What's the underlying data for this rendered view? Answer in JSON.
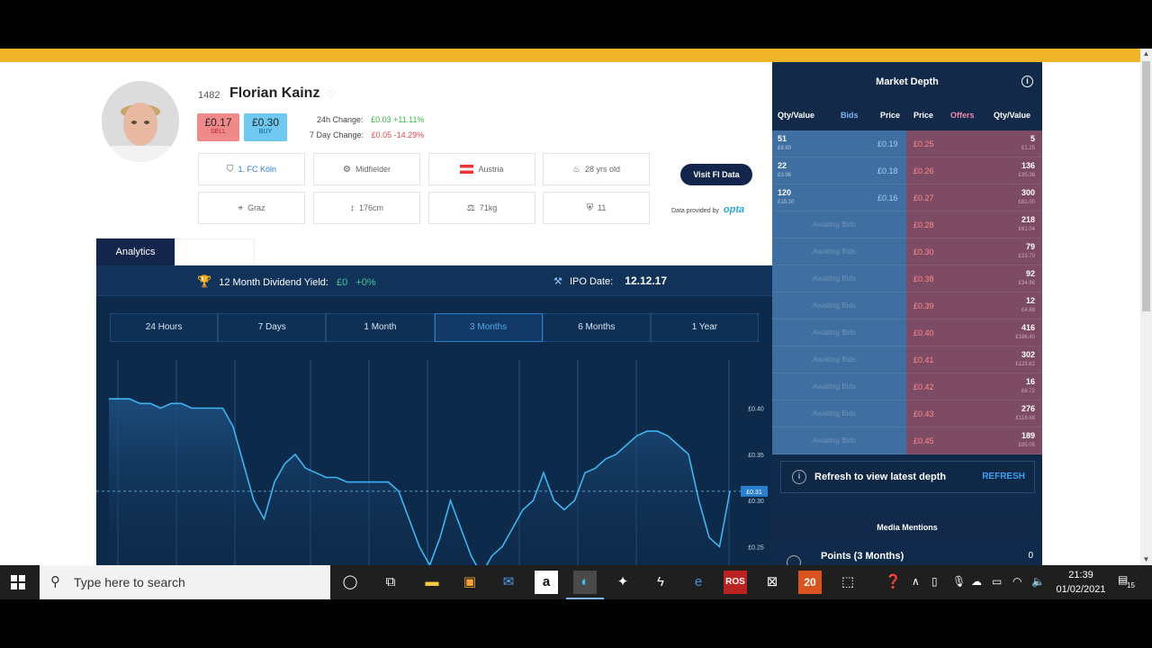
{
  "player": {
    "id": "1482",
    "name": "Florian Kainz",
    "sell_price": "£0.17",
    "sell_label": "SELL",
    "buy_price": "£0.30",
    "buy_label": "BUY",
    "change_24h_label": "24h Change:",
    "change_24h_value": "£0.03 +11.11%",
    "change_7d_label": "7 Day Change:",
    "change_7d_value": "£0.05 -14.29%",
    "info": {
      "club": "1. FC Köln",
      "position": "Midfielder",
      "country": "Austria",
      "age": "28 yrs old",
      "birthplace": "Graz",
      "height": "176cm",
      "weight": "71kg",
      "shirt": "11"
    },
    "visit_label": "Visit FI Data",
    "data_provided_label": "Data provided by",
    "data_provider": "opta"
  },
  "analytics": {
    "tab_label": "Analytics",
    "dividend_label": "12 Month Dividend Yield:",
    "dividend_value": "£0",
    "dividend_pct": "+0%",
    "ipo_label": "IPO Date:",
    "ipo_value": "12.12.17",
    "periods": [
      "24 Hours",
      "7 Days",
      "1 Month",
      "3 Months",
      "6 Months",
      "1 Year"
    ],
    "active_period": "3 Months"
  },
  "chart_data": {
    "type": "line",
    "y_ticks": [
      "£0.40",
      "£0.35",
      "£0.30",
      "£0.25"
    ],
    "ylim": [
      0.23,
      0.455
    ],
    "current_price_label": "£0.31",
    "current_price": 0.31,
    "values": [
      0.41,
      0.41,
      0.41,
      0.405,
      0.405,
      0.4,
      0.405,
      0.405,
      0.4,
      0.4,
      0.4,
      0.4,
      0.38,
      0.34,
      0.3,
      0.28,
      0.32,
      0.34,
      0.35,
      0.335,
      0.33,
      0.325,
      0.325,
      0.32,
      0.32,
      0.32,
      0.32,
      0.32,
      0.31,
      0.28,
      0.25,
      0.23,
      0.26,
      0.3,
      0.27,
      0.24,
      0.22,
      0.24,
      0.25,
      0.27,
      0.29,
      0.3,
      0.33,
      0.3,
      0.29,
      0.3,
      0.33,
      0.335,
      0.345,
      0.35,
      0.36,
      0.37,
      0.375,
      0.375,
      0.37,
      0.36,
      0.35,
      0.3,
      0.26,
      0.25,
      0.31
    ],
    "line_color": "#3fb4f0"
  },
  "market_depth": {
    "title": "Market Depth",
    "columns": {
      "qty_left": "Qty/Value",
      "bids": "Bids",
      "price_left": "Price",
      "price_right": "Price",
      "offers": "Offers",
      "qty_right": "Qty/Value"
    },
    "awaiting_label": "Awaiting Bids",
    "rows": [
      {
        "bid_qty": "51",
        "bid_val": "£9.69",
        "bid_price": "£0.19",
        "offer_price": "£0.25",
        "offer_qty": "5",
        "offer_val": "£1.25"
      },
      {
        "bid_qty": "22",
        "bid_val": "£3.96",
        "bid_price": "£0.18",
        "offer_price": "£0.26",
        "offer_qty": "136",
        "offer_val": "£35.36"
      },
      {
        "bid_qty": "120",
        "bid_val": "£19.20",
        "bid_price": "£0.16",
        "offer_price": "£0.27",
        "offer_qty": "300",
        "offer_val": "£81.00"
      },
      {
        "offer_price": "£0.28",
        "offer_qty": "218",
        "offer_val": "£61.04"
      },
      {
        "offer_price": "£0.30",
        "offer_qty": "79",
        "offer_val": "£23.70"
      },
      {
        "offer_price": "£0.38",
        "offer_qty": "92",
        "offer_val": "£34.96"
      },
      {
        "offer_price": "£0.39",
        "offer_qty": "12",
        "offer_val": "£4.68"
      },
      {
        "offer_price": "£0.40",
        "offer_qty": "416",
        "offer_val": "£166.40"
      },
      {
        "offer_price": "£0.41",
        "offer_qty": "302",
        "offer_val": "£123.82"
      },
      {
        "offer_price": "£0.42",
        "offer_qty": "16",
        "offer_val": "£6.72"
      },
      {
        "offer_price": "£0.43",
        "offer_qty": "276",
        "offer_val": "£118.68"
      },
      {
        "offer_price": "£0.45",
        "offer_qty": "189",
        "offer_val": "£85.05"
      }
    ],
    "refresh_text": "Refresh to view latest depth",
    "refresh_button": "REFRESH",
    "media_mentions": "Media Mentions",
    "points_label": "Points (3 Months)",
    "points_value": "0"
  },
  "taskbar": {
    "search_placeholder": "Type here to search",
    "badge_app": "20",
    "ros_label": "ROS",
    "time": "21:39",
    "date": "01/02/2021",
    "notifications": "15"
  },
  "colors": {
    "brand_navy": "#13254a",
    "accent_orange": "#f0b429",
    "sell": "#f08a8a",
    "buy": "#6ec8f2",
    "chart_bg": "#0d2a4a"
  }
}
